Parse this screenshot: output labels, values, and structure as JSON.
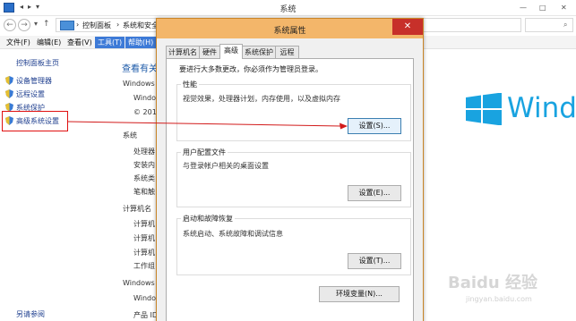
{
  "window": {
    "title": "系统",
    "quick_access": [
      "◂",
      "▸",
      "▾"
    ],
    "win_controls": [
      "—",
      "□",
      "✕"
    ]
  },
  "address": {
    "crumbs": [
      "控制面板",
      "系统和安全"
    ],
    "separators": [
      "›",
      "›"
    ]
  },
  "menubar": {
    "items": [
      "文件(F)",
      "编辑(E)",
      "查看(V)",
      "工具(T)",
      "帮助(H)"
    ]
  },
  "leftpane": {
    "home": "控制面板主页",
    "items": [
      "设备管理器",
      "远程设置",
      "系统保护",
      "高级系统设置"
    ]
  },
  "background": {
    "heading": "查看有关",
    "lines": [
      "Windows",
      "Windo",
      "© 201",
      "系统",
      "处理器",
      "安装内",
      "系统类",
      "笔和触",
      "计算机名",
      "计算机",
      "计算机",
      "计算机",
      "工作组",
      "Windows",
      "Windo",
      "产品 ID"
    ],
    "brand_text": "Windo",
    "link": "另请参阅"
  },
  "dialog": {
    "title": "系统属性",
    "close": "✕",
    "tabs": [
      "计算机名",
      "硬件",
      "高级",
      "系统保护",
      "远程"
    ],
    "intro": "要进行大多数更改，你必须作为管理员登录。",
    "groups": [
      {
        "label": "性能",
        "desc": "视觉效果，处理器计划，内存使用，以及虚拟内存",
        "button": "设置(S)..."
      },
      {
        "label": "用户配置文件",
        "desc": "与登录帐户相关的桌面设置",
        "button": "设置(E)..."
      },
      {
        "label": "启动和故障恢复",
        "desc": "系统启动、系统故障和调试信息",
        "button": "设置(T)..."
      }
    ],
    "env_button": "环境变量(N)..."
  },
  "watermark": {
    "text": "Baidu 经验",
    "sub": "jingyan.baidu.com"
  },
  "colors": {
    "dialog_title": "#f3b66a",
    "close_button": "#c7302a",
    "link": "#1f3f8f",
    "highlight_box": "#e01010",
    "windows_blue": "#19a3e0"
  }
}
